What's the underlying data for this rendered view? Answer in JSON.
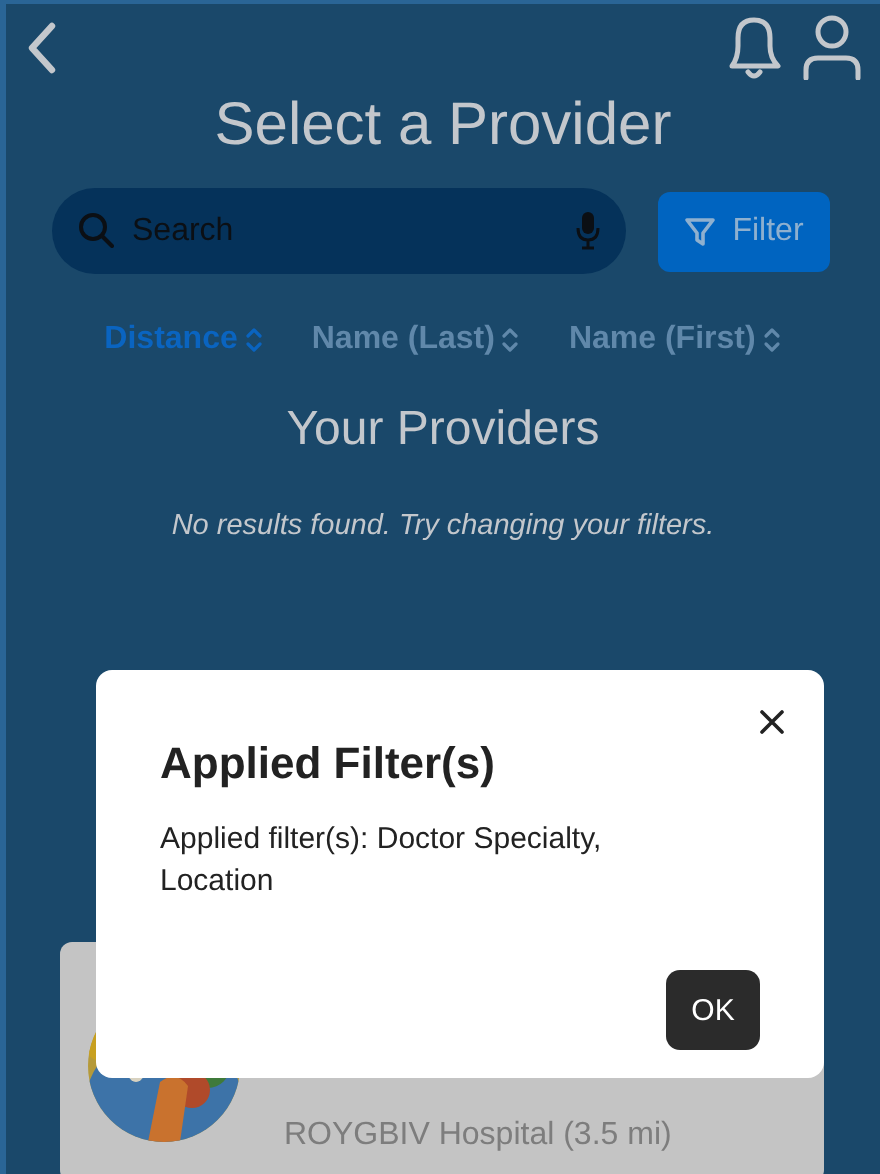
{
  "header": {
    "title": "Select a Provider"
  },
  "search": {
    "placeholder": "Search"
  },
  "filter_button": {
    "label": "Filter"
  },
  "sort_options": [
    {
      "label": "Distance",
      "selected": true
    },
    {
      "label": "Name (Last)",
      "selected": false
    },
    {
      "label": "Name (First)",
      "selected": false
    }
  ],
  "section_title": "Your Providers",
  "empty_message": "No results found. Try changing your filters.",
  "provider_card": {
    "location": "ROYGBIV Hospital (3.5 mi)"
  },
  "dialog": {
    "title": "Applied Filter(s)",
    "message": "Applied filter(s): Doctor Specialty, Location",
    "button": "OK"
  }
}
